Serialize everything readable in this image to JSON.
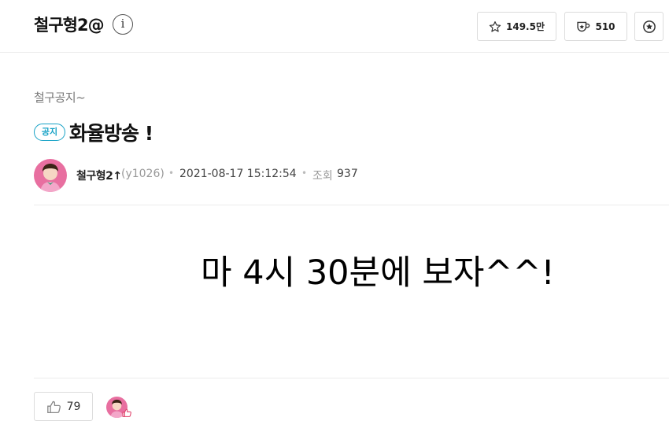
{
  "header": {
    "channel_name": "철구형2@",
    "info_label": "i",
    "favorites_count": "149.5만",
    "subscribers_count": "510"
  },
  "post": {
    "category": "철구공지~",
    "badge": "공지",
    "title": "화율방송 !",
    "author": "철구형2",
    "author_id": "(y1026)",
    "separator": "•",
    "date": "2021-08-17 15:12:54",
    "views_label": "조회",
    "views": "937",
    "content": "마 4시 30분에 보자^^!"
  },
  "footer": {
    "up_count": "79"
  },
  "colors": {
    "accent": "#17a2c6",
    "border": "#dcdcdc",
    "avatar_bg": "#e86fa0"
  }
}
